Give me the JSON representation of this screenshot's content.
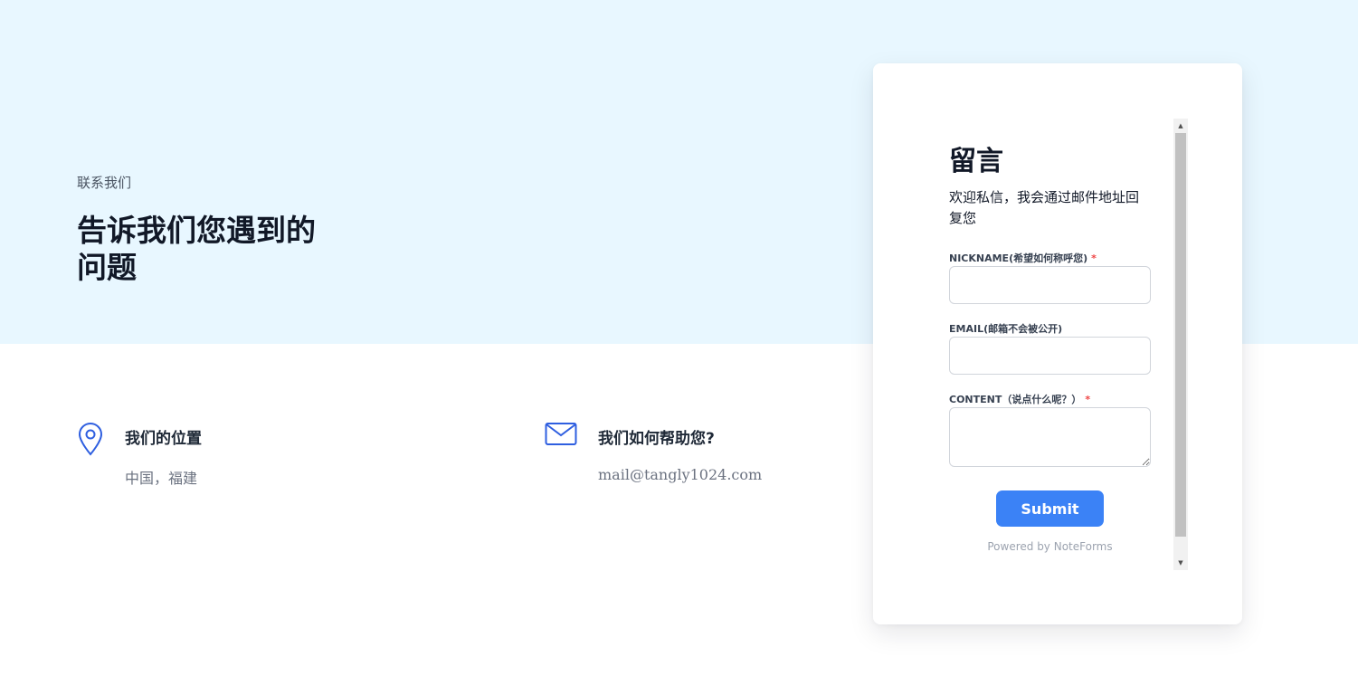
{
  "hero": {
    "eyebrow": "联系我们",
    "headline": "告诉我们您遇到的问题"
  },
  "contact_info": {
    "location": {
      "icon": "location-pin-icon",
      "title": "我们的位置",
      "value": "中国，福建"
    },
    "email": {
      "icon": "envelope-icon",
      "title": "我们如何帮助您?",
      "value": "mail@tangly1024.com"
    }
  },
  "form": {
    "title": "留言",
    "description": "欢迎私信，我会通过邮件地址回复您",
    "fields": {
      "nickname": {
        "label": "NICKNAME(希望如何称呼您)",
        "required_mark": "*",
        "value": ""
      },
      "email": {
        "label": "EMAIL(邮箱不会被公开)",
        "value": ""
      },
      "content": {
        "label": "CONTENT（说点什么呢？）",
        "required_mark": "*",
        "value": ""
      }
    },
    "submit_label": "Submit",
    "powered_by": "Powered by NoteForms"
  },
  "colors": {
    "hero_background": "#e8f7ff",
    "accent": "#3b82f6",
    "icon": "#2f5fe0",
    "required": "#ef4444"
  }
}
